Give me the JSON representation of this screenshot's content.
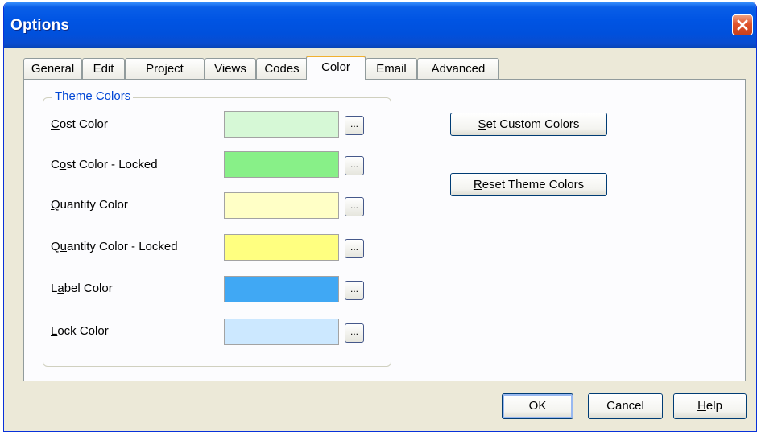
{
  "window": {
    "title": "Options"
  },
  "tabs": [
    {
      "label": "General",
      "active": false
    },
    {
      "label": "Edit",
      "active": false
    },
    {
      "label": "Project",
      "active": false
    },
    {
      "label": "Views",
      "active": false
    },
    {
      "label": "Codes",
      "active": false
    },
    {
      "label": "Color",
      "active": true
    },
    {
      "label": "Email",
      "active": false
    },
    {
      "label": "Advanced",
      "active": false
    }
  ],
  "theme_group": {
    "title": "Theme Colors",
    "rows": [
      {
        "label_pre": "",
        "label_key": "C",
        "label_post": "ost Color",
        "color": "#d6f8d6"
      },
      {
        "label_pre": "C",
        "label_key": "o",
        "label_post": "st Color - Locked",
        "color": "#88f088"
      },
      {
        "label_pre": "",
        "label_key": "Q",
        "label_post": "uantity Color",
        "color": "#ffffc6"
      },
      {
        "label_pre": "Q",
        "label_key": "u",
        "label_post": "antity Color - Locked",
        "color": "#ffff80"
      },
      {
        "label_pre": "L",
        "label_key": "a",
        "label_post": "bel Color",
        "color": "#40a8f4"
      },
      {
        "label_pre": "",
        "label_key": "L",
        "label_post": "ock Color",
        "color": "#cce8ff"
      }
    ],
    "pick_label": "..."
  },
  "side_buttons": {
    "set_custom": {
      "key": "S",
      "rest": "et Custom Colors"
    },
    "reset_theme": {
      "key": "R",
      "rest": "eset Theme Colors"
    }
  },
  "footer": {
    "ok": "OK",
    "cancel": "Cancel",
    "help": {
      "key": "H",
      "rest": "elp"
    }
  }
}
